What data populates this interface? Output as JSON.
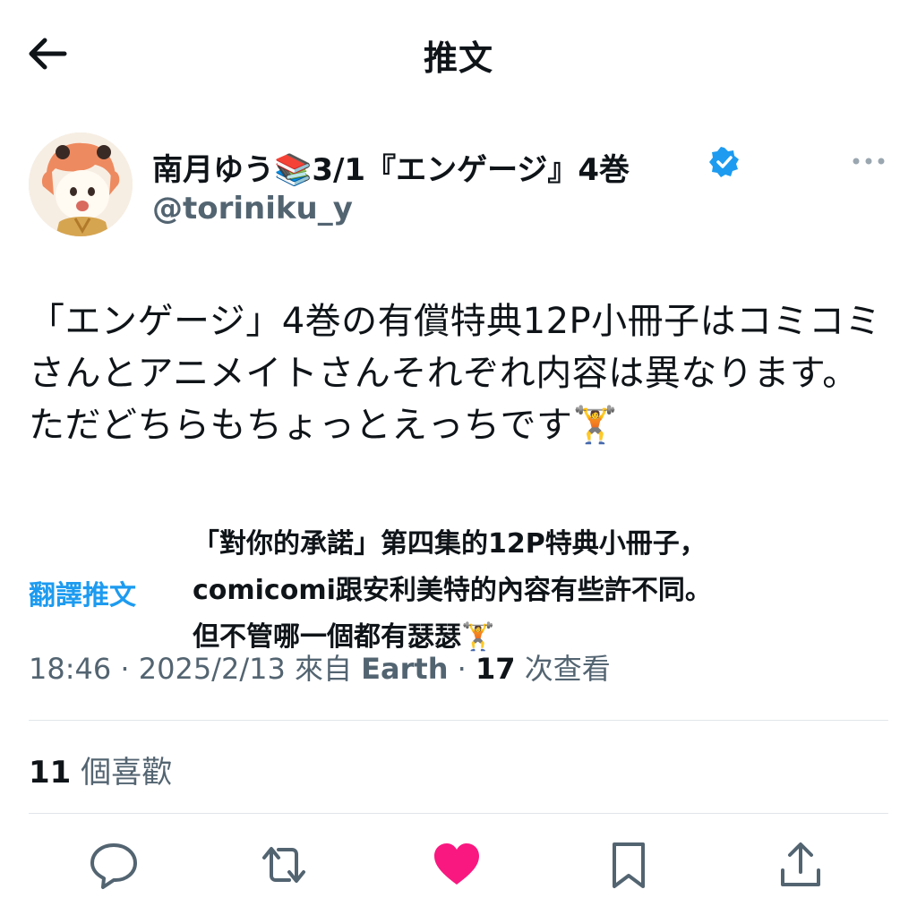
{
  "header": {
    "title": "推文"
  },
  "author": {
    "display_name": "南月ゆう📚3/1『エンゲージ』4巻",
    "handle": "@toriniku_y"
  },
  "tweet": {
    "text": "「エンゲージ」4巻の有償特典12P小冊子はコミコミさんとアニメイトさんそれぞれ内容は異なります。\nただどちらもちょっとえっちです🏋",
    "translate_label": "翻譯推文",
    "translation": "「對你的承諾」第四集的12P特典小冊子，\ncomicomi跟安利美特的內容有些許不同。\n但不管哪一個都有瑟瑟🏋"
  },
  "meta": {
    "time": "18:46",
    "date": "2025/2/13",
    "source_prefix": "來自",
    "source": "Earth",
    "views_count": "17",
    "views_label": "次查看",
    "separator": "·"
  },
  "engagement": {
    "likes_count": "11",
    "likes_label": "個喜歡"
  },
  "colors": {
    "accent": "#1d9bf0",
    "like": "#f91880",
    "secondary_text": "#536471",
    "icon": "#536471"
  },
  "icons": {
    "back": "arrow-left-icon",
    "verified": "verified-badge-icon",
    "more": "more-horizontal-icon",
    "reply": "reply-icon",
    "retweet": "retweet-icon",
    "like": "heart-filled-icon",
    "bookmark": "bookmark-icon",
    "share": "share-icon"
  }
}
